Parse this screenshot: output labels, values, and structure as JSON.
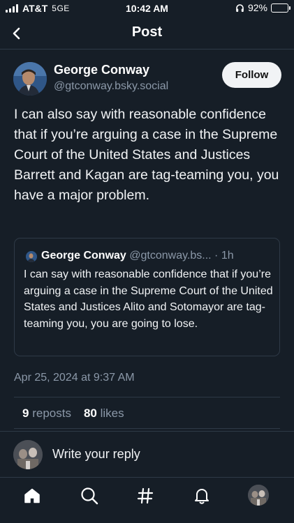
{
  "status_bar": {
    "carrier": "AT&T",
    "network": "5GE",
    "time": "10:42 AM",
    "battery_text": "92%",
    "battery_level": 0.92
  },
  "header": {
    "title": "Post"
  },
  "post": {
    "author_name": "George Conway",
    "author_handle": "@gtconway.bsky.social",
    "follow_label": "Follow",
    "text": "I can also say with reasonable confidence that if you’re arguing a case in the Supreme Court of the United States and Justices Barrett and Kagan are tag-teaming you, you have a major problem.",
    "quote": {
      "author_name": "George Conway",
      "author_handle": "@gtconway.bs...",
      "separator": "·",
      "age": "1h",
      "text": "I can say with reasonable confidence that if you’re arguing a case in the Supreme Court of the United States and Justices Alito and Sotomayor are tag-teaming you, you are going to lose."
    },
    "date": "Apr 25, 2024 at 9:37 AM",
    "reposts_count": "9",
    "reposts_label": "reposts",
    "likes_count": "80",
    "likes_label": "likes"
  },
  "reply": {
    "placeholder": "Write your reply"
  },
  "tabs": [
    {
      "icon": "home-icon"
    },
    {
      "icon": "search-icon"
    },
    {
      "icon": "hashtag-icon"
    },
    {
      "icon": "bell-icon"
    },
    {
      "icon": "profile-avatar"
    }
  ],
  "colors": {
    "background": "#161e27",
    "border": "#2e3a47",
    "secondary_text": "#8b98a8",
    "primary_text": "#f1f3f5"
  }
}
